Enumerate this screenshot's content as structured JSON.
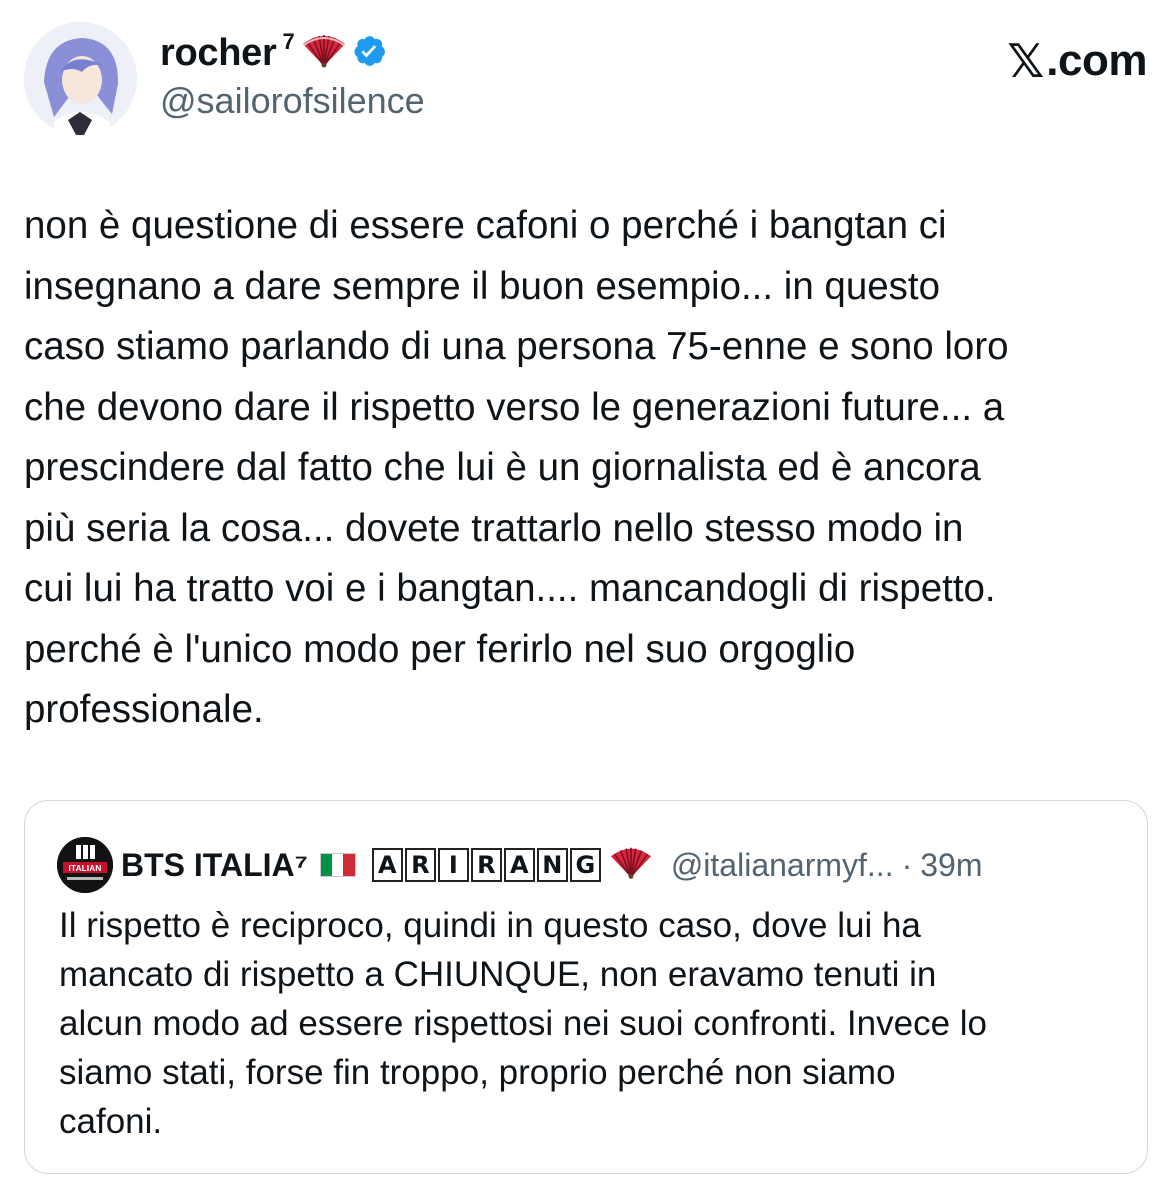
{
  "author": {
    "display_name": "rocher",
    "superscript": "7",
    "handle": "@sailorofsilence",
    "verified": true
  },
  "brand": {
    "logo_glyph": "𝕏",
    "domain": ".com"
  },
  "tweet": {
    "text": "non è questione di essere cafoni o perché i bangtan ci\ninsegnano a dare sempre il buon esempio... in questo\ncaso stiamo parlando di una persona 75-enne e sono loro\nche devono dare il rispetto verso le generazioni future... a\nprescindere dal fatto che lui è un giornalista ed è ancora\npiù seria la cosa... dovete trattarlo nello stesso modo in\ncui lui ha tratto voi e i bangtan.... mancandogli di rispetto.\nperché è l'unico modo per ferirlo nel suo orgoglio\nprofessionale."
  },
  "quoted_tweet": {
    "avatar_text": "ITALIAN",
    "display_name": "BTS ITALIA⁷",
    "boxed_letters": [
      "A",
      "R",
      "I",
      "R",
      "A",
      "N",
      "G"
    ],
    "handle": "@italianarmyf...",
    "separator": "·",
    "time": "39m",
    "text": "Il rispetto è reciproco, quindi in questo caso, dove lui ha\nmancato di rispetto a CHIUNQUE, non eravamo tenuti in\nalcun modo ad essere rispettosi nei suoi confronti. Invece lo\nsiamo stati, forse fin troppo, proprio perché non siamo\ncafoni."
  },
  "colors": {
    "verified": "#1d9bf0",
    "secondary_text": "#536471",
    "border": "#cfd9de"
  },
  "icons": [
    "fan-icon",
    "verified-badge-icon",
    "italy-flag-icon"
  ]
}
